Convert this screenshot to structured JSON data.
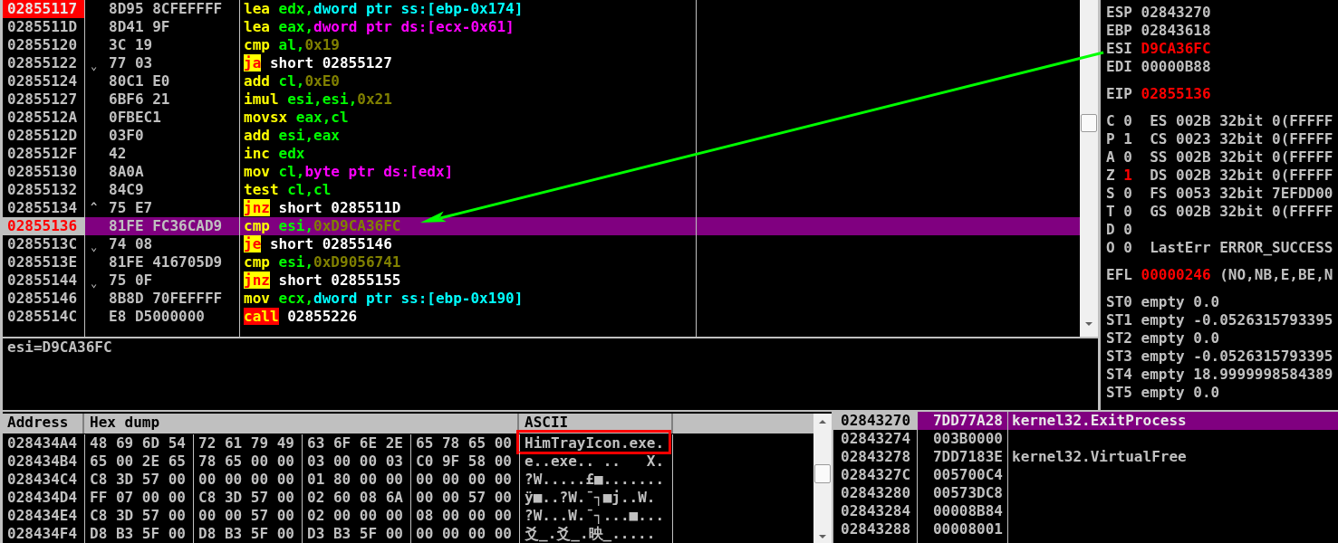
{
  "disassembly": {
    "rows": [
      {
        "address": "02855117",
        "hex": "8D95 8CFEFFFF",
        "instruction": [
          {
            "text": "lea",
            "kind": "mnemonic"
          },
          {
            "text": "edx",
            "kind": "register"
          },
          {
            "text": ",",
            "kind": "separator"
          },
          {
            "text": "dword ptr ss:[ebp-0x174]",
            "kind": "stack_operand"
          }
        ],
        "breakpoint": true,
        "selected": false
      },
      {
        "address": "0285511D",
        "hex": "8D41 9F",
        "instruction": [
          {
            "text": "lea",
            "kind": "mnemonic"
          },
          {
            "text": "eax",
            "kind": "register"
          },
          {
            "text": ",",
            "kind": "separator"
          },
          {
            "text": "dword ptr ds:[ecx-0x61]",
            "kind": "memory_operand"
          }
        ],
        "breakpoint": false,
        "selected": false
      },
      {
        "address": "02855120",
        "hex": "3C 19",
        "instruction": [
          {
            "text": "cmp",
            "kind": "mnemonic"
          },
          {
            "text": "al",
            "kind": "register"
          },
          {
            "text": ",",
            "kind": "separator"
          },
          {
            "text": "0x19",
            "kind": "constant"
          }
        ],
        "breakpoint": false,
        "selected": false
      },
      {
        "address": "02855122",
        "jump_mark": "⌄",
        "hex": "77 03",
        "instruction": [
          {
            "text": "ja",
            "kind": "jump"
          },
          {
            "text": "short 02855127",
            "kind": "target"
          }
        ],
        "breakpoint": false,
        "selected": false
      },
      {
        "address": "02855124",
        "hex": "80C1 E0",
        "instruction": [
          {
            "text": "add",
            "kind": "mnemonic"
          },
          {
            "text": "cl",
            "kind": "register"
          },
          {
            "text": ",",
            "kind": "separator"
          },
          {
            "text": "0xE0",
            "kind": "constant"
          }
        ],
        "breakpoint": false,
        "selected": false
      },
      {
        "address": "02855127",
        "hex": "6BF6 21",
        "instruction": [
          {
            "text": "imul",
            "kind": "mnemonic"
          },
          {
            "text": "esi",
            "kind": "register"
          },
          {
            "text": ",",
            "kind": "separator"
          },
          {
            "text": "esi",
            "kind": "register"
          },
          {
            "text": ",",
            "kind": "separator"
          },
          {
            "text": "0x21",
            "kind": "constant"
          }
        ],
        "breakpoint": false,
        "selected": false
      },
      {
        "address": "0285512A",
        "hex": "0FBEC1",
        "instruction": [
          {
            "text": "movsx",
            "kind": "mnemonic"
          },
          {
            "text": "eax",
            "kind": "register"
          },
          {
            "text": ",",
            "kind": "separator"
          },
          {
            "text": "cl",
            "kind": "register"
          }
        ],
        "breakpoint": false,
        "selected": false
      },
      {
        "address": "0285512D",
        "hex": "03F0",
        "instruction": [
          {
            "text": "add",
            "kind": "mnemonic"
          },
          {
            "text": "esi",
            "kind": "register"
          },
          {
            "text": ",",
            "kind": "separator"
          },
          {
            "text": "eax",
            "kind": "register"
          }
        ],
        "breakpoint": false,
        "selected": false
      },
      {
        "address": "0285512F",
        "hex": "42",
        "instruction": [
          {
            "text": "inc",
            "kind": "mnemonic"
          },
          {
            "text": "edx",
            "kind": "register"
          }
        ],
        "breakpoint": false,
        "selected": false
      },
      {
        "address": "02855130",
        "hex": "8A0A",
        "instruction": [
          {
            "text": "mov",
            "kind": "mnemonic"
          },
          {
            "text": "cl",
            "kind": "register"
          },
          {
            "text": ",",
            "kind": "separator"
          },
          {
            "text": "byte ptr ds:[edx]",
            "kind": "memory_operand"
          }
        ],
        "breakpoint": false,
        "selected": false
      },
      {
        "address": "02855132",
        "hex": "84C9",
        "instruction": [
          {
            "text": "test",
            "kind": "mnemonic"
          },
          {
            "text": "cl",
            "kind": "register"
          },
          {
            "text": ",",
            "kind": "separator"
          },
          {
            "text": "cl",
            "kind": "register"
          }
        ],
        "breakpoint": false,
        "selected": false
      },
      {
        "address": "02855134",
        "jump_mark": "^",
        "hex": "75 E7",
        "instruction": [
          {
            "text": "jnz",
            "kind": "jump"
          },
          {
            "text": "short 0285511D",
            "kind": "target"
          }
        ],
        "breakpoint": false,
        "selected": false
      },
      {
        "address": "02855136",
        "hex": "81FE FC36CAD9",
        "instruction": [
          {
            "text": "cmp",
            "kind": "mnemonic"
          },
          {
            "text": "esi",
            "kind": "register"
          },
          {
            "text": ",",
            "kind": "separator"
          },
          {
            "text": "0xD9CA36FC",
            "kind": "constant"
          }
        ],
        "breakpoint": false,
        "selected": true
      },
      {
        "address": "0285513C",
        "jump_mark": "⌄",
        "hex": "74 08",
        "instruction": [
          {
            "text": "je",
            "kind": "jump"
          },
          {
            "text": "short 02855146",
            "kind": "target"
          }
        ],
        "breakpoint": false,
        "selected": false
      },
      {
        "address": "0285513E",
        "hex": "81FE 416705D9",
        "instruction": [
          {
            "text": "cmp",
            "kind": "mnemonic"
          },
          {
            "text": "esi",
            "kind": "register"
          },
          {
            "text": ",",
            "kind": "separator"
          },
          {
            "text": "0xD9056741",
            "kind": "constant"
          }
        ],
        "breakpoint": false,
        "selected": false
      },
      {
        "address": "02855144",
        "jump_mark": "⌄",
        "hex": "75 0F",
        "instruction": [
          {
            "text": "jnz",
            "kind": "jump"
          },
          {
            "text": "short 02855155",
            "kind": "target"
          }
        ],
        "breakpoint": false,
        "selected": false
      },
      {
        "address": "02855146",
        "hex": "8B8D 70FEFFFF",
        "instruction": [
          {
            "text": "mov",
            "kind": "mnemonic"
          },
          {
            "text": "ecx",
            "kind": "register"
          },
          {
            "text": ",",
            "kind": "separator"
          },
          {
            "text": "dword ptr ss:[ebp-0x190]",
            "kind": "stack_operand"
          }
        ],
        "breakpoint": false,
        "selected": false
      },
      {
        "address": "0285514C",
        "hex": "E8 D5000000",
        "instruction": [
          {
            "text": "call",
            "kind": "call"
          },
          {
            "text": "02855226",
            "kind": "target"
          }
        ],
        "breakpoint": false,
        "selected": false
      }
    ]
  },
  "info_line": "esi=D9CA36FC",
  "registers": {
    "general": [
      {
        "name": "ESP",
        "value": "02843270",
        "changed": false
      },
      {
        "name": "EBP",
        "value": "02843618",
        "changed": false
      },
      {
        "name": "ESI",
        "value": "D9CA36FC",
        "changed": true
      },
      {
        "name": "EDI",
        "value": "00000B88",
        "changed": false
      }
    ],
    "eip": {
      "name": "EIP",
      "value": "02855136",
      "changed": true
    },
    "flags": [
      {
        "flag": "C",
        "value": "0",
        "changed": false,
        "segment": "ES 002B 32bit 0(FFFFF"
      },
      {
        "flag": "P",
        "value": "1",
        "changed": false,
        "segment": "CS 0023 32bit 0(FFFFF"
      },
      {
        "flag": "A",
        "value": "0",
        "changed": false,
        "segment": "SS 002B 32bit 0(FFFFF"
      },
      {
        "flag": "Z",
        "value": "1",
        "changed": true,
        "segment": "DS 002B 32bit 0(FFFFF"
      },
      {
        "flag": "S",
        "value": "0",
        "changed": false,
        "segment": "FS 0053 32bit 7EFDD00"
      },
      {
        "flag": "T",
        "value": "0",
        "changed": false,
        "segment": "GS 002B 32bit 0(FFFFF"
      },
      {
        "flag": "D",
        "value": "0",
        "changed": false
      },
      {
        "flag": "O",
        "value": "0",
        "changed": false,
        "last_error": "LastErr ERROR_SUCCESS"
      }
    ],
    "efl": {
      "name": "EFL",
      "value": "00000246",
      "changed": true,
      "decoded": "(NO,NB,E,BE,N"
    },
    "fpu": [
      {
        "name": "ST0",
        "tag": "empty",
        "value": "0.0"
      },
      {
        "name": "ST1",
        "tag": "empty",
        "value": "-0.0526315793395"
      },
      {
        "name": "ST2",
        "tag": "empty",
        "value": "0.0"
      },
      {
        "name": "ST3",
        "tag": "empty",
        "value": "-0.0526315793395"
      },
      {
        "name": "ST4",
        "tag": "empty",
        "value": "18.9999998584389"
      },
      {
        "name": "ST5",
        "tag": "empty",
        "value": "0.0"
      }
    ]
  },
  "dump": {
    "columns": [
      "Address",
      "Hex dump",
      "ASCII"
    ],
    "rows": [
      {
        "address": "028434A4",
        "hex_groups": [
          "48 69 6D 54",
          "72 61 79 49",
          "63 6F 6E 2E",
          "65 78 65 00"
        ],
        "ascii": "HimTrayIcon.exe.",
        "highlighted": true
      },
      {
        "address": "028434B4",
        "hex_groups": [
          "65 00 2E 65",
          "78 65 00 00",
          "03 00 00 03",
          "C0 9F 58 00"
        ],
        "ascii": "e..exe.. ..   X.",
        "highlighted": false
      },
      {
        "address": "028434C4",
        "hex_groups": [
          "C8 3D 57 00",
          "00 00 00 00",
          "01 80 00 00",
          "00 00 00 00"
        ],
        "ascii": "?W.....£■.......",
        "highlighted": false
      },
      {
        "address": "028434D4",
        "hex_groups": [
          "FF 07 00 00",
          "C8 3D 57 00",
          "02 60 08 6A",
          "00 00 57 00"
        ],
        "ascii": "ÿ■..?W.¯┐■j..W.",
        "highlighted": false
      },
      {
        "address": "028434E4",
        "hex_groups": [
          "C8 3D 57 00",
          "00 00 57 00",
          "02 00 00 00",
          "08 00 00 00"
        ],
        "ascii": "?W...W.¯┐...■...",
        "highlighted": false
      },
      {
        "address": "028434F4",
        "hex_groups": [
          "D8 B3 5F 00",
          "D8 B3 5F 00",
          "D3 B3 5F 00",
          "00 00 00 00"
        ],
        "ascii": "爻_.爻_.映_.....",
        "highlighted": false
      }
    ]
  },
  "stack": {
    "rows": [
      {
        "address": "02843270",
        "value": "7DD77A28",
        "comment": "kernel32.ExitProcess",
        "selected": true
      },
      {
        "address": "02843274",
        "value": "003B0000",
        "selected": false
      },
      {
        "address": "02843278",
        "value": "7DD7183E",
        "comment": "kernel32.VirtualFree",
        "selected": false
      },
      {
        "address": "0284327C",
        "value": "005700C4",
        "selected": false
      },
      {
        "address": "02843280",
        "value": "00573DC8",
        "selected": false
      },
      {
        "address": "02843284",
        "value": "00008B84",
        "selected": false
      },
      {
        "address": "02843288",
        "value": "00008001",
        "selected": false
      }
    ]
  }
}
